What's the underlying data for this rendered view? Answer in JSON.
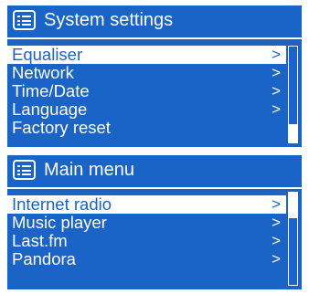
{
  "system_settings": {
    "title": "System settings",
    "icon": "menu-list-icon",
    "items": [
      {
        "label": "Equaliser",
        "arrow": ">",
        "selected": true
      },
      {
        "label": "Network",
        "arrow": ">",
        "selected": false
      },
      {
        "label": "Time/Date",
        "arrow": ">",
        "selected": false
      },
      {
        "label": "Language",
        "arrow": ">",
        "selected": false
      },
      {
        "label": "Factory reset",
        "arrow": "",
        "selected": false
      }
    ],
    "scroll_position_fraction": 0.82
  },
  "main_menu": {
    "title": "Main menu",
    "icon": "menu-list-icon",
    "items": [
      {
        "label": "Internet radio",
        "arrow": ">",
        "selected": true
      },
      {
        "label": "Music player",
        "arrow": ">",
        "selected": false
      },
      {
        "label": "Last.fm",
        "arrow": ">",
        "selected": false
      },
      {
        "label": "Pandora",
        "arrow": ">",
        "selected": false
      }
    ],
    "scroll_position_fraction": 0.3
  },
  "colors": {
    "screen_background": "#1a64c8",
    "text": "#ffffff"
  }
}
